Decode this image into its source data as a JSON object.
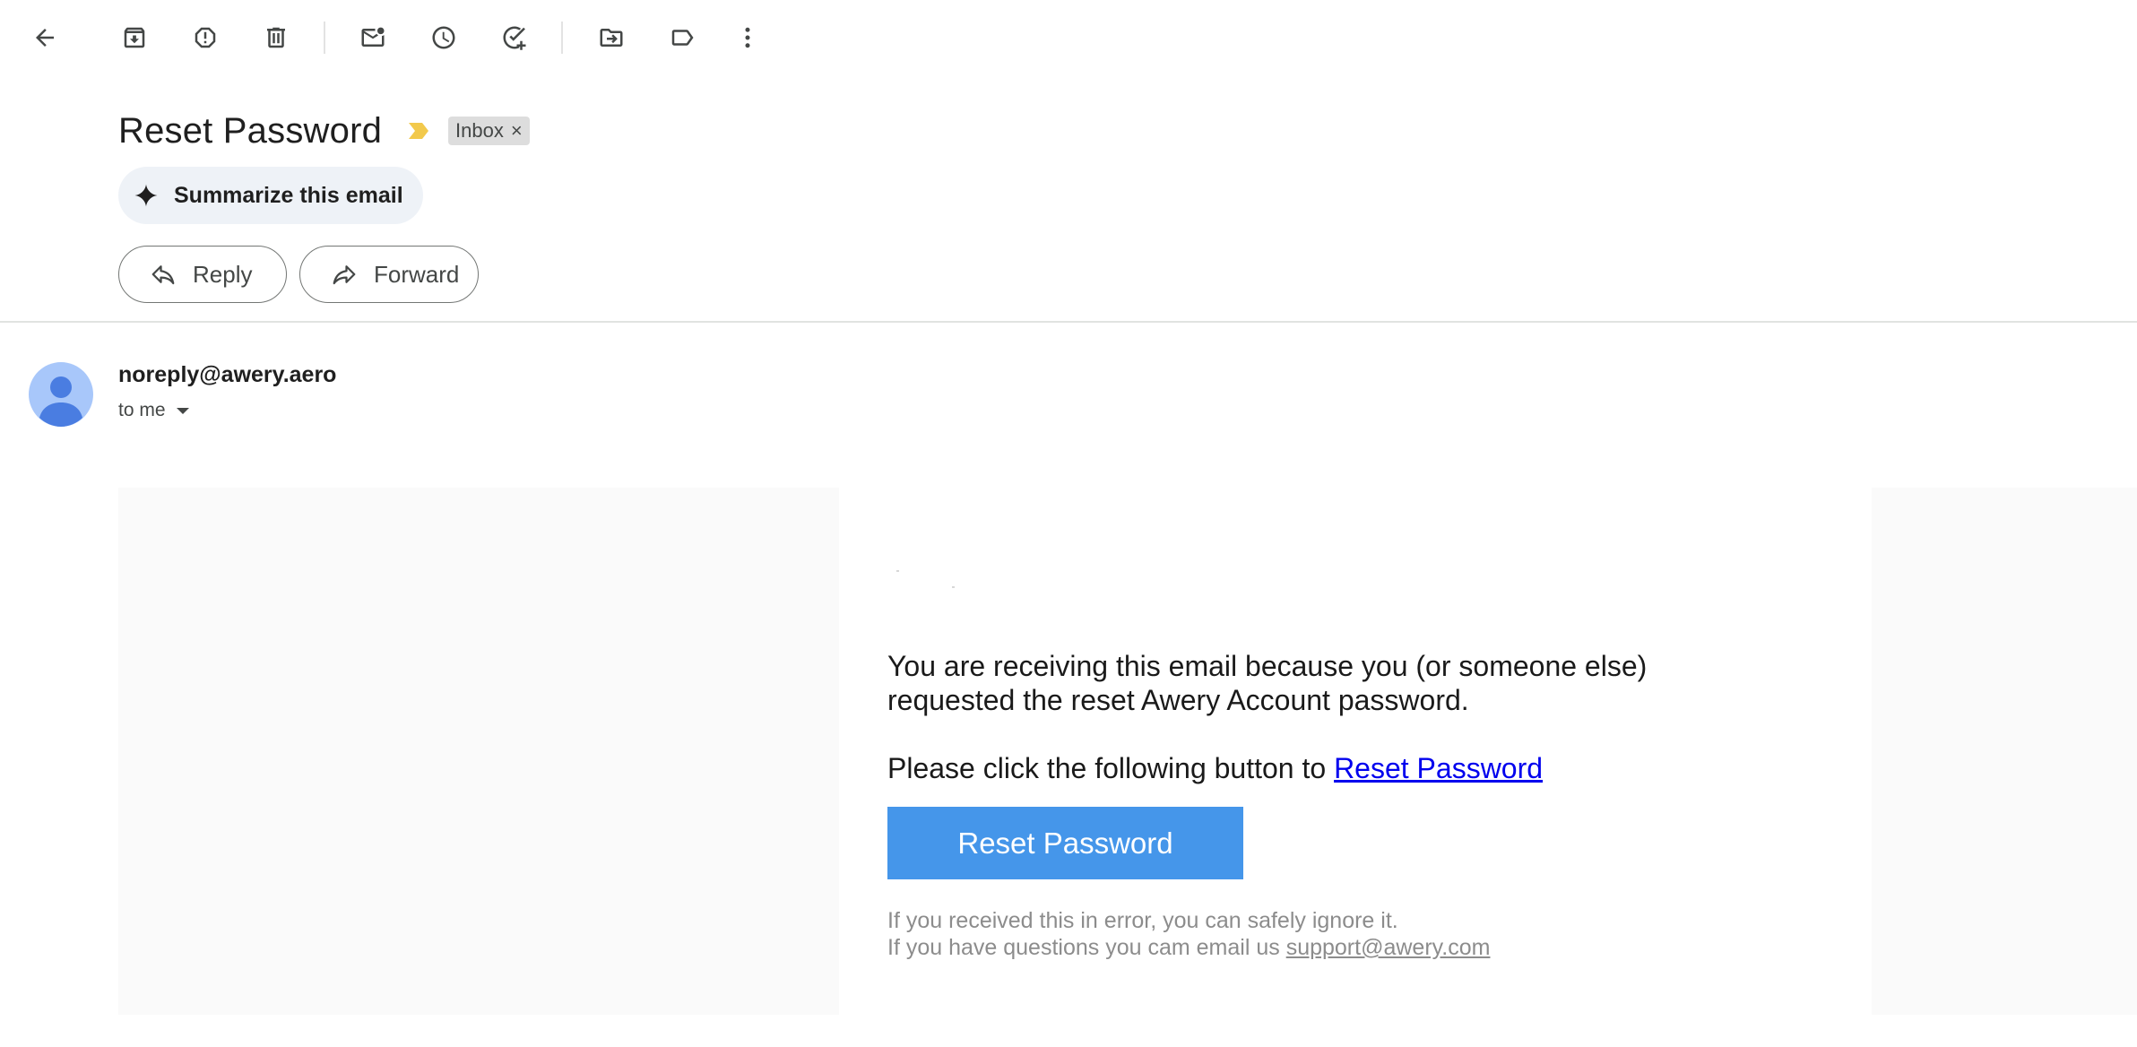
{
  "toolbar": {
    "back": "back-arrow-icon",
    "archive": "archive-icon",
    "report_spam": "report-spam-icon",
    "delete": "trash-icon",
    "mark_unread": "mark-unread-icon",
    "snooze": "snooze-clock-icon",
    "add_task": "add-task-icon",
    "move_to": "move-to-folder-icon",
    "labels": "label-icon",
    "more": "more-vert-icon"
  },
  "email": {
    "subject": "Reset Password",
    "label_chip": "Inbox",
    "label_chip_close": "×",
    "summarize_label": "Summarize this email",
    "reply_label": "Reply",
    "forward_label": "Forward",
    "sender": "noreply@awery.aero",
    "recipient": "to me"
  },
  "body": {
    "paragraph1_line1": "You are receiving this email because you (or someone else)",
    "paragraph1_line2": "requested the reset Awery Account password.",
    "paragraph2_prefix": "Please click the following button to ",
    "paragraph2_link": "Reset Password",
    "button_label": "Reset Password",
    "footer_line1": "If you received this in error, you can safely ignore it.",
    "footer_line2_prefix": "If you have questions you cam email us ",
    "footer_email": "support@awery.com"
  },
  "colors": {
    "cta_button": "#4596ea",
    "importance_marker": "#f2c94c",
    "avatar_bg": "#a8c7fa",
    "avatar_fg": "#4a7de1",
    "link": "#0000ee"
  }
}
